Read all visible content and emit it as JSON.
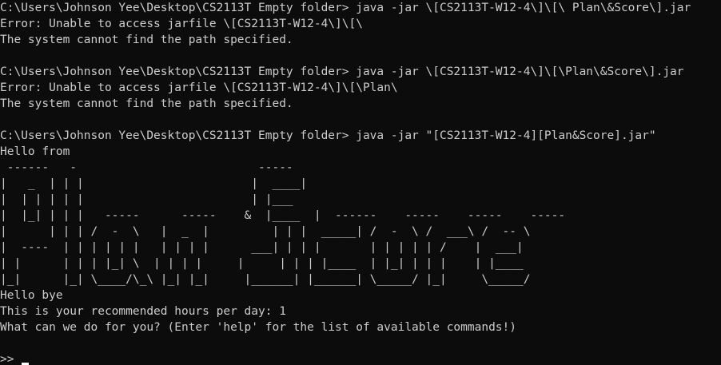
{
  "terminal": {
    "lines": [
      "C:\\Users\\Johnson Yee\\Desktop\\CS2113T Empty folder> java -jar \\[CS2113T-W12-4\\]\\[\\ Plan\\&Score\\].jar",
      "Error: Unable to access jarfile \\[CS2113T-W12-4\\]\\[\\",
      "The system cannot find the path specified.",
      "",
      "C:\\Users\\Johnson Yee\\Desktop\\CS2113T Empty folder> java -jar \\[CS2113T-W12-4\\]\\[\\Plan\\&Score\\].jar",
      "Error: Unable to access jarfile \\[CS2113T-W12-4\\]\\[\\Plan\\",
      "The system cannot find the path specified.",
      "",
      "C:\\Users\\Johnson Yee\\Desktop\\CS2113T Empty folder> java -jar \"[CS2113T-W12-4][Plan&Score].jar\"",
      "Hello from"
    ],
    "logo": [
      " ------   -                          -----",
      "|   _  | | |                        |  ____|",
      "|  | | | | |                        | |___",
      "|  |_| | | |   -----      -----    &  |____  |  ------    -----    -----    -----",
      "|      | | | /  -  \\   |  _  |         | | |  _____| /  -  \\ /  ___\\ /  -- \\",
      "|  ----  | | | | | |   | | | |      ___| | | |       | | | | | /    |  ___|",
      "| |      | | | |_| \\  | | | |     |     | | | |____  | |_| | | |    | |____",
      "|_|      |_| \\____/\\_\\ |_| |_|     |______| |______| \\_____/ |_|     \\_____/"
    ],
    "after": [
      "Hello bye",
      "This is your recommended hours per day: 1",
      "What can we do for you? (Enter 'help' for the list of available commands!)",
      ""
    ],
    "prompt": ">>"
  }
}
